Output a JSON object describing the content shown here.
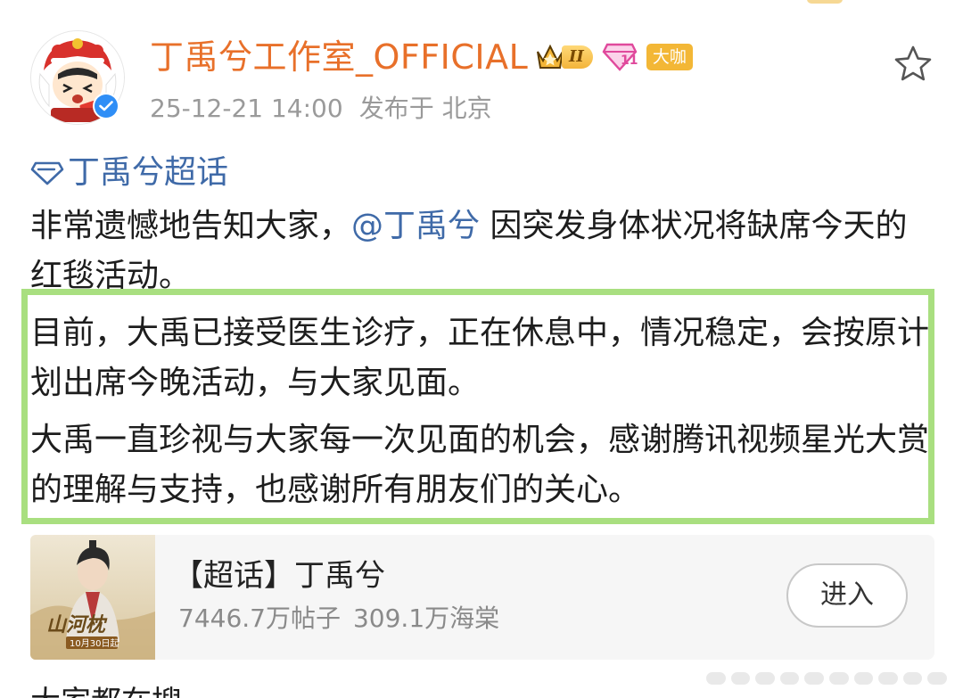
{
  "post": {
    "author": {
      "name": "丁禹兮工作室_OFFICIAL",
      "rank_badge": "II",
      "vip_icon": "gem-member-icon",
      "tag": "大咖",
      "verified": true,
      "avatar_icon": "lion-dance-avatar"
    },
    "meta": {
      "time": "25-12-21 14:00",
      "location": "发布于 北京"
    },
    "topic": "丁禹兮超话",
    "paragraph1": {
      "before": "非常遗憾地告知大家，",
      "mention": "@丁禹兮",
      "after": " 因突发身体状况将缺席今天的红毯活动。"
    },
    "paragraph2": "目前，大禹已接受医生诊疗，正在休息中，情况稳定，会按原计划出席今晚活动，与大家见面。",
    "paragraph3": "大禹一直珍视与大家每一次见面的机会，感谢腾讯视频星光大赏的理解与支持，也感谢所有朋友们的关心。",
    "highlight_color": "#a9df80"
  },
  "card": {
    "title": "【超话】丁禹兮",
    "posts": "7446.7万帖子",
    "members": "309.1万海棠",
    "enter_label": "进入",
    "poster_text": "山河枕",
    "poster_date": "10月30日起"
  },
  "next_text_partial": "大家都在搜",
  "colors": {
    "username": "#e8702a",
    "link": "#3f6aa8",
    "meta": "#9a9a9a"
  }
}
